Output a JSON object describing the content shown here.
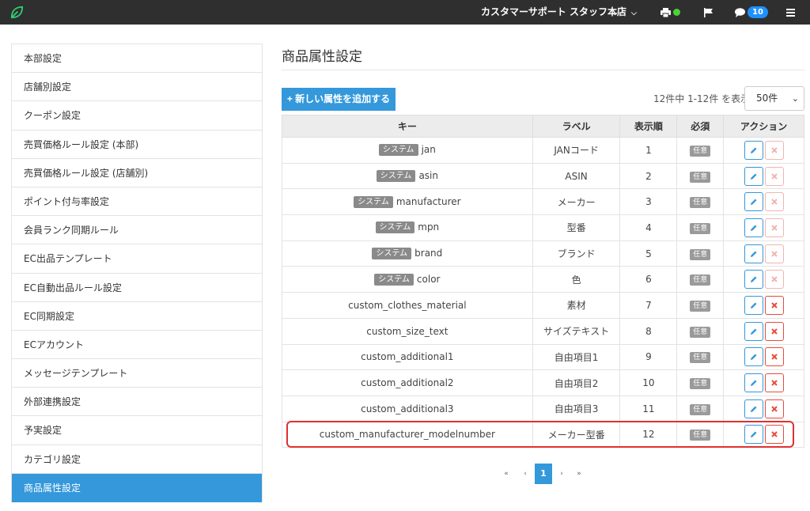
{
  "topbar": {
    "staff_menu": "カスタマーサポート スタッフ",
    "store_menu": "本店",
    "notification_count": "10",
    "colors": {
      "bg": "#2f2f2f",
      "status": "#4cd137",
      "badge": "#1e90ff"
    }
  },
  "sidebar": {
    "items": [
      {
        "label": "本部設定"
      },
      {
        "label": "店舗別設定"
      },
      {
        "label": "クーポン設定"
      },
      {
        "label": "売買価格ルール設定 (本部)"
      },
      {
        "label": "売買価格ルール設定 (店舗別)"
      },
      {
        "label": "ポイント付与率設定"
      },
      {
        "label": "会員ランク同期ルール"
      },
      {
        "label": "EC出品テンプレート"
      },
      {
        "label": "EC自動出品ルール設定"
      },
      {
        "label": "EC同期設定"
      },
      {
        "label": "ECアカウント"
      },
      {
        "label": "メッセージテンプレート"
      },
      {
        "label": "外部連携設定"
      },
      {
        "label": "予実設定"
      },
      {
        "label": "カテゴリ設定"
      },
      {
        "label": "商品属性設定",
        "active": true
      }
    ]
  },
  "main": {
    "title": "商品属性設定",
    "add_button": "新しい属性を追加する",
    "count_text": "12件中 1-12件 を表示",
    "per_page": "50件",
    "columns": [
      "キー",
      "ラベル",
      "表示順",
      "必須",
      "アクション"
    ],
    "system_badge": "システム",
    "required_badge": "任意",
    "rows": [
      {
        "key": "jan",
        "system": true,
        "label": "JANコード",
        "order": "1"
      },
      {
        "key": "asin",
        "system": true,
        "label": "ASIN",
        "order": "2"
      },
      {
        "key": "manufacturer",
        "system": true,
        "label": "メーカー",
        "order": "3"
      },
      {
        "key": "mpn",
        "system": true,
        "label": "型番",
        "order": "4"
      },
      {
        "key": "brand",
        "system": true,
        "label": "ブランド",
        "order": "5"
      },
      {
        "key": "color",
        "system": true,
        "label": "色",
        "order": "6"
      },
      {
        "key": "custom_clothes_material",
        "system": false,
        "label": "素材",
        "order": "7"
      },
      {
        "key": "custom_size_text",
        "system": false,
        "label": "サイズテキスト",
        "order": "8"
      },
      {
        "key": "custom_additional1",
        "system": false,
        "label": "自由項目1",
        "order": "9"
      },
      {
        "key": "custom_additional2",
        "system": false,
        "label": "自由項目2",
        "order": "10"
      },
      {
        "key": "custom_additional3",
        "system": false,
        "label": "自由項目3",
        "order": "11"
      },
      {
        "key": "custom_manufacturer_modelnumber",
        "system": false,
        "label": "メーカー型番",
        "order": "12"
      }
    ]
  },
  "pagination": {
    "first": "«",
    "prev": "‹",
    "current": "1",
    "next": "›",
    "last": "»"
  }
}
